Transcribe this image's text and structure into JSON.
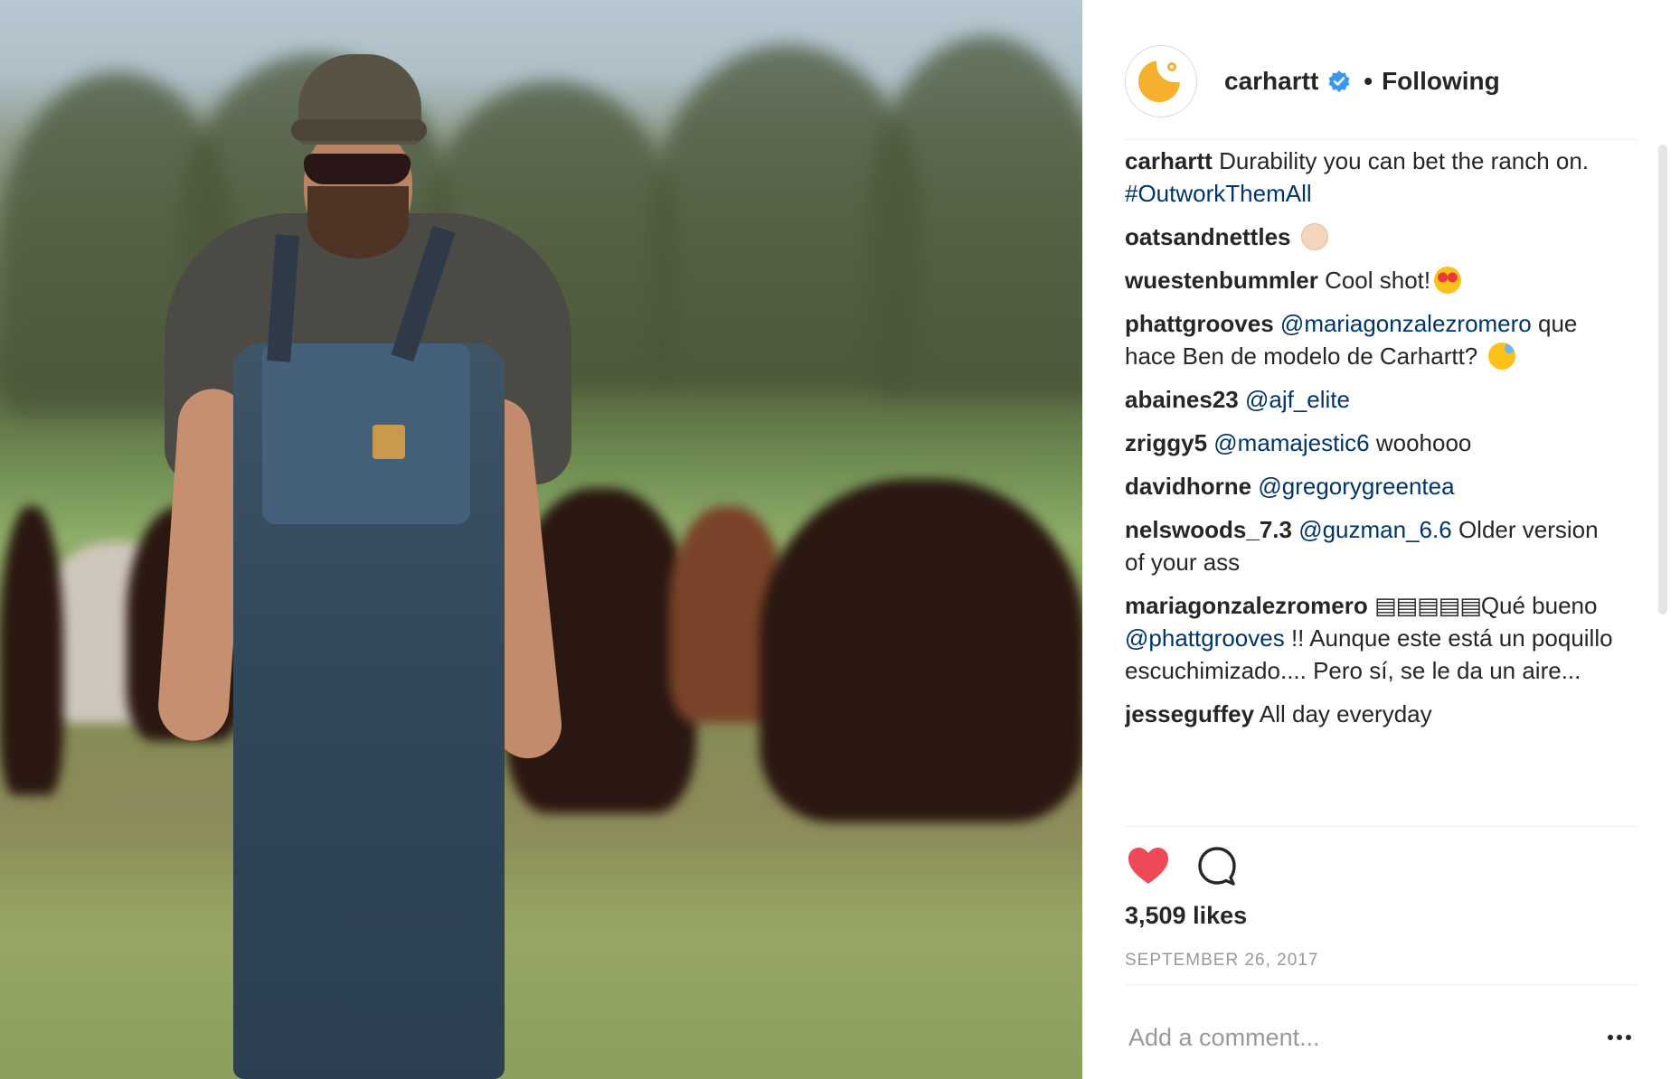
{
  "post": {
    "image_alt": "",
    "author": {
      "username": "carhartt",
      "verified": true,
      "separator": "•",
      "follow_status": "Following"
    },
    "caption": {
      "username": "carhartt",
      "text": "Durability you can bet the ranch on.",
      "hashtag": "#OutworkThemAll"
    },
    "comments": [
      {
        "username": "oatsandnettles",
        "parts": [],
        "emoji": "ok-hand"
      },
      {
        "username": "wuestenbummler",
        "text": "Cool shot!",
        "emoji": "heart-eyes"
      },
      {
        "username": "phattgrooves",
        "mention": "@mariagonzalezromero",
        "text": "que hace Ben de modelo de Carhartt?",
        "emoji": "sweat-smile"
      },
      {
        "username": "abaines23",
        "mention": "@ajf_elite"
      },
      {
        "username": "zriggy5",
        "mention": "@mamajestic6",
        "text": "woohooo"
      },
      {
        "username": "davidhorne",
        "mention": "@gregorygreentea"
      },
      {
        "username": "nelswoods_7.3",
        "mention": "@guzman_6.6",
        "text": "Older version of your ass"
      },
      {
        "username": "mariagonzalezromero",
        "flags": "▤▤▤▤▤",
        "text_a": "Qué bueno",
        "mention": "@phattgrooves",
        "text_b": "!! Aunque este está un poquillo escuchimizado.... Pero sí, se le da un aire..."
      },
      {
        "username": "jesseguffey",
        "text": "All day everyday"
      }
    ],
    "likes": "3,509 likes",
    "date": "SEPTEMBER 26, 2017",
    "add_comment_placeholder": "Add a comment...",
    "colors": {
      "heart": "#ed4956",
      "link": "#003569",
      "verified": "#3897f0",
      "muted": "#999999",
      "brand_logo": "#f5b02e"
    },
    "icons": [
      "heart-icon",
      "comment-icon",
      "more-options-icon",
      "verified-badge-icon"
    ]
  }
}
